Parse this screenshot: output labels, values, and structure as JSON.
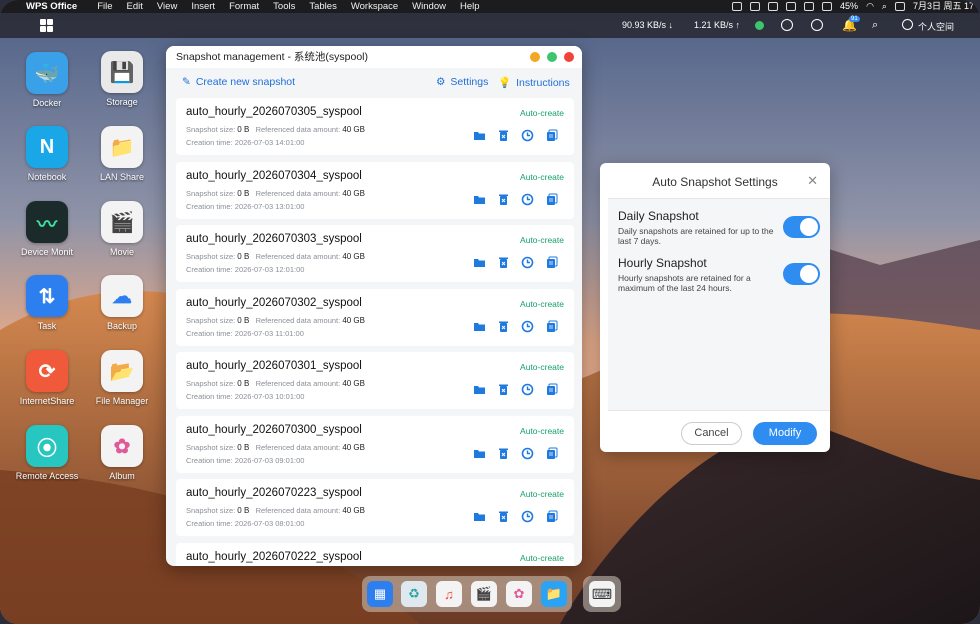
{
  "menubar": {
    "app_name": "WPS Office",
    "items": [
      "File",
      "Edit",
      "View",
      "Insert",
      "Format",
      "Tools",
      "Tables",
      "Workspace",
      "Window",
      "Help"
    ],
    "battery": "45%",
    "datetime": "7月3日 周五 17"
  },
  "taskbar": {
    "download_speed": "90.93 KB/s ↓",
    "upload_speed": "1.21 KB/s ↑",
    "notification_count": "91",
    "user_label": "个人空间"
  },
  "desktop": {
    "icons": [
      {
        "label": "Docker",
        "color": "#3aa0e8",
        "glyph": "🐳"
      },
      {
        "label": "Storage",
        "color": "#e9e9e9",
        "glyph": "💾"
      },
      {
        "label": "Notebook",
        "color": "#1aa7e8",
        "glyph": "N"
      },
      {
        "label": "LAN Share",
        "color": "#f3f3f3",
        "glyph": "📁"
      },
      {
        "label": "Device Monit",
        "color": "#1b2b2b",
        "glyph": "〰"
      },
      {
        "label": "Movie",
        "color": "#f3f3f3",
        "glyph": "🎬"
      },
      {
        "label": "Task",
        "color": "#2d7ff0",
        "glyph": "⇅"
      },
      {
        "label": "Backup",
        "color": "#f3f3f3",
        "glyph": "☁"
      },
      {
        "label": "InternetShare",
        "color": "#f05a3a",
        "glyph": "⟳"
      },
      {
        "label": "File Manager",
        "color": "#f3f3f3",
        "glyph": "📂"
      },
      {
        "label": "Remote Access",
        "color": "#27c6c0",
        "glyph": "⦿"
      },
      {
        "label": "Album",
        "color": "#f3f3f3",
        "glyph": "✿"
      }
    ]
  },
  "snapshot_window": {
    "title": "Snapshot management - 系统池(syspool)",
    "create_label": "Create new snapshot",
    "settings_label": "Settings",
    "instructions_label": "Instructions",
    "size_label": "Snapshot size:",
    "ref_label": "Referenced data amount:",
    "time_label": "Creation time:",
    "snapshots": [
      {
        "name": "auto_hourly_2026070305_syspool",
        "badge": "Auto-create",
        "size": "0 B",
        "ref": "40 GB",
        "time": "2026-07-03 14:01:00"
      },
      {
        "name": "auto_hourly_2026070304_syspool",
        "badge": "Auto-create",
        "size": "0 B",
        "ref": "40 GB",
        "time": "2026-07-03 13:01:00"
      },
      {
        "name": "auto_hourly_2026070303_syspool",
        "badge": "Auto-create",
        "size": "0 B",
        "ref": "40 GB",
        "time": "2026-07-03 12:01:00"
      },
      {
        "name": "auto_hourly_2026070302_syspool",
        "badge": "Auto-create",
        "size": "0 B",
        "ref": "40 GB",
        "time": "2026-07-03 11:01:00"
      },
      {
        "name": "auto_hourly_2026070301_syspool",
        "badge": "Auto-create",
        "size": "0 B",
        "ref": "40 GB",
        "time": "2026-07-03 10:01:00"
      },
      {
        "name": "auto_hourly_2026070300_syspool",
        "badge": "Auto-create",
        "size": "0 B",
        "ref": "40 GB",
        "time": "2026-07-03 09:01:00"
      },
      {
        "name": "auto_hourly_2026070223_syspool",
        "badge": "Auto-create",
        "size": "0 B",
        "ref": "40 GB",
        "time": "2026-07-03 08:01:00"
      },
      {
        "name": "auto_hourly_2026070222_syspool",
        "badge": "Auto-create",
        "size": "",
        "ref": "",
        "time": ""
      }
    ]
  },
  "auto_dialog": {
    "title": "Auto Snapshot Settings",
    "close_glyph": "✕",
    "daily_title": "Daily Snapshot",
    "daily_desc": "Daily snapshots are retained for up to the last 7 days.",
    "daily_enabled": true,
    "hourly_title": "Hourly Snapshot",
    "hourly_desc": "Hourly snapshots are retained for a maximum of the last 24 hours.",
    "hourly_enabled": true,
    "cancel_label": "Cancel",
    "modify_label": "Modify"
  },
  "dock": {
    "items": [
      {
        "icon": "grid-icon",
        "color": "#2d7ff0",
        "glyph": "▦"
      },
      {
        "icon": "recycle-bin-icon",
        "color": "#dfe8ef",
        "glyph": "♻"
      },
      {
        "icon": "music-icon",
        "color": "#f3f3f3",
        "glyph": "♫"
      },
      {
        "icon": "movie-icon",
        "color": "#f3f3f3",
        "glyph": "🎬"
      },
      {
        "icon": "album-icon",
        "color": "#f3f3f3",
        "glyph": "✿"
      },
      {
        "icon": "folder-icon",
        "color": "#2aa3f5",
        "glyph": "📁"
      }
    ]
  },
  "colors": {
    "accent": "#2f8cf0",
    "auto_badge": "#17a06a",
    "link": "#1f6fd6"
  }
}
